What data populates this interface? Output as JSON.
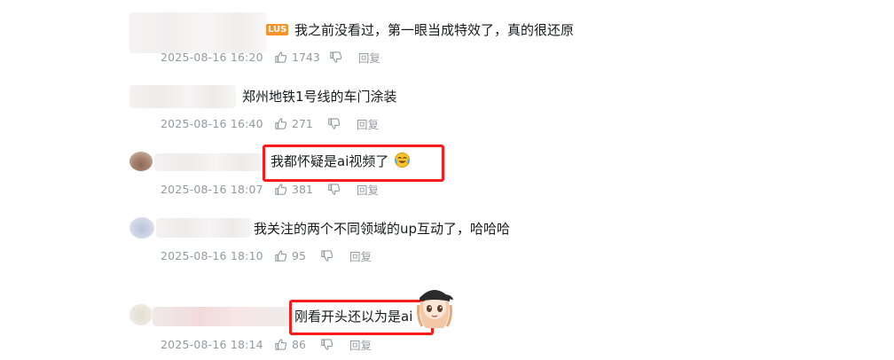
{
  "comments": [
    {
      "text": "我之前没看过，第一眼当成特效了，真的很还原",
      "badge": "LUS",
      "time": "2025-08-16 16:20",
      "likes": "1743",
      "reply": "回复"
    },
    {
      "text": "郑州地铁1号线的车门涂装",
      "time": "2025-08-16 16:40",
      "likes": "271",
      "reply": "回复"
    },
    {
      "text": "我都怀疑是ai视频了",
      "emoji": "laughing-crying-emoji",
      "time": "2025-08-16 18:07",
      "likes": "381",
      "reply": "回复"
    },
    {
      "text": "我关注的两个不同领域的up互动了，哈哈哈",
      "time": "2025-08-16 18:10",
      "likes": "95",
      "reply": "回复"
    },
    {
      "text": "刚看开头还以为是ai",
      "time": "2025-08-16 18:14",
      "likes": "86",
      "reply": "回复",
      "sticker": "anime-girl-sticker"
    }
  ],
  "colors": {
    "highlight": "#ff1a1a",
    "meta_text": "#9499a0",
    "badge": "#f7932b"
  }
}
